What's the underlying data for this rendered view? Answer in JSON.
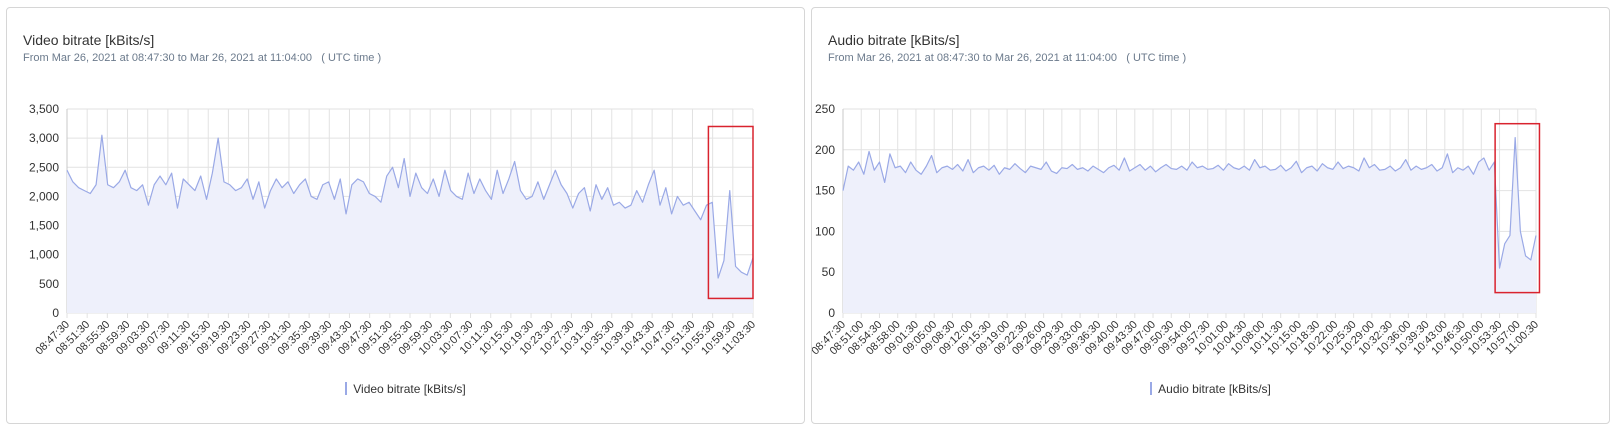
{
  "charts": [
    {
      "title": "Video bitrate [kBits/s]",
      "subtitle": "From Mar 26, 2021 at 08:47:30 to Mar 26, 2021 at 11:04:00",
      "timezone_note": "( UTC time )",
      "legend_label": "Video bitrate [kBits/s]"
    },
    {
      "title": "Audio bitrate [kBits/s]",
      "subtitle": "From Mar 26, 2021 at 08:47:30 to Mar 26, 2021 at 11:04:00",
      "timezone_note": "( UTC time )",
      "legend_label": "Audio bitrate [kBits/s]"
    }
  ],
  "colors": {
    "line": "#9aa9e6",
    "fill": "#eef0fb",
    "grid": "#e2e2e2",
    "axis_text": "#333333",
    "highlight_box": "#d9232e"
  },
  "chart_data": [
    {
      "type": "area",
      "title": "Video bitrate [kBits/s]",
      "series": [
        {
          "name": "Video bitrate [kBits/s]",
          "values": [
            2450,
            2250,
            2150,
            2100,
            2050,
            2200,
            3050,
            2200,
            2150,
            2250,
            2450,
            2150,
            2100,
            2200,
            1850,
            2200,
            2350,
            2200,
            2400,
            1800,
            2300,
            2200,
            2100,
            2350,
            1950,
            2400,
            3000,
            2250,
            2200,
            2100,
            2150,
            2300,
            1950,
            2250,
            1800,
            2100,
            2300,
            2150,
            2250,
            2050,
            2200,
            2300,
            2000,
            1950,
            2200,
            2250,
            1950,
            2300,
            1700,
            2200,
            2300,
            2250,
            2050,
            2000,
            1900,
            2350,
            2500,
            2150,
            2650,
            2000,
            2400,
            2150,
            2050,
            2300,
            2000,
            2450,
            2100,
            2000,
            1950,
            2400,
            2050,
            2300,
            2100,
            1950,
            2450,
            2050,
            2300,
            2600,
            2100,
            1950,
            2000,
            2250,
            1950,
            2200,
            2450,
            2200,
            2050,
            1800,
            2050,
            2150,
            1750,
            2200,
            1950,
            2150,
            1850,
            1900,
            1800,
            1850,
            2100,
            1900,
            2200,
            2450,
            1850,
            2150,
            1700,
            2000,
            1850,
            1900,
            1750,
            1600,
            1850,
            1900,
            600,
            900,
            2100,
            800,
            700,
            650,
            950
          ]
        }
      ],
      "x_tick_labels": [
        "08:47:30",
        "08:51:30",
        "08:55:30",
        "08:59:30",
        "09:03:30",
        "09:07:30",
        "09:11:30",
        "09:15:30",
        "09:19:30",
        "09:23:30",
        "09:27:30",
        "09:31:30",
        "09:35:30",
        "09:39:30",
        "09:43:30",
        "09:47:30",
        "09:51:30",
        "09:55:30",
        "09:59:30",
        "10:03:30",
        "10:07:30",
        "10:11:30",
        "10:15:30",
        "10:19:30",
        "10:23:30",
        "10:27:30",
        "10:31:30",
        "10:35:30",
        "10:39:30",
        "10:43:30",
        "10:47:30",
        "10:51:30",
        "10:55:30",
        "10:59:30",
        "11:03:30"
      ],
      "y_ticks": [
        0,
        500,
        1000,
        1500,
        2000,
        2500,
        3000,
        3500
      ],
      "y_tick_labels": [
        "0",
        "500",
        "1,000",
        "1,500",
        "2,000",
        "2,500",
        "3,000",
        "3,500"
      ],
      "ylim": [
        0,
        3500
      ],
      "grid": true,
      "legend_position": "bottom",
      "highlight": {
        "from_fraction": 0.935,
        "to_fraction": 1.0,
        "y_from": 250,
        "y_to": 3200
      }
    },
    {
      "type": "area",
      "title": "Audio bitrate [kBits/s]",
      "series": [
        {
          "name": "Audio bitrate [kBits/s]",
          "values": [
            150,
            180,
            175,
            185,
            170,
            198,
            175,
            185,
            160,
            195,
            178,
            180,
            172,
            185,
            175,
            170,
            180,
            193,
            172,
            178,
            180,
            176,
            182,
            174,
            188,
            172,
            178,
            180,
            175,
            181,
            170,
            178,
            176,
            183,
            177,
            172,
            180,
            178,
            176,
            185,
            174,
            171,
            178,
            177,
            182,
            176,
            178,
            174,
            180,
            176,
            172,
            178,
            181,
            175,
            190,
            174,
            178,
            182,
            175,
            180,
            173,
            178,
            182,
            177,
            176,
            180,
            175,
            185,
            178,
            180,
            176,
            177,
            181,
            175,
            183,
            178,
            176,
            180,
            175,
            188,
            178,
            180,
            175,
            176,
            181,
            174,
            178,
            186,
            172,
            178,
            180,
            174,
            183,
            178,
            176,
            185,
            177,
            180,
            178,
            174,
            190,
            178,
            182,
            175,
            176,
            180,
            174,
            178,
            188,
            175,
            180,
            176,
            178,
            182,
            174,
            178,
            195,
            172,
            178,
            175,
            180,
            170,
            185,
            190,
            175,
            185,
            55,
            85,
            95,
            215,
            100,
            70,
            65,
            95
          ]
        }
      ],
      "x_tick_labels": [
        "08:47:30",
        "08:51:00",
        "08:54:30",
        "08:58:00",
        "09:01:30",
        "09:05:00",
        "09:08:30",
        "09:12:00",
        "09:15:30",
        "09:19:00",
        "09:22:30",
        "09:26:00",
        "09:29:30",
        "09:33:00",
        "09:36:30",
        "09:40:00",
        "09:43:30",
        "09:47:00",
        "09:50:30",
        "09:54:00",
        "09:57:30",
        "10:01:00",
        "10:04:30",
        "10:08:00",
        "10:11:30",
        "10:15:00",
        "10:18:30",
        "10:22:00",
        "10:25:30",
        "10:29:00",
        "10:32:30",
        "10:36:00",
        "10:39:30",
        "10:43:00",
        "10:46:30",
        "10:50:00",
        "10:53:30",
        "10:57:00",
        "11:00:30"
      ],
      "y_ticks": [
        0,
        50,
        100,
        150,
        200,
        250
      ],
      "y_tick_labels": [
        "0",
        "50",
        "100",
        "150",
        "200",
        "250"
      ],
      "ylim": [
        0,
        250
      ],
      "grid": true,
      "legend_position": "bottom",
      "highlight": {
        "from_fraction": 0.941,
        "to_fraction": 1.005,
        "y_from": 25,
        "y_to": 232
      }
    }
  ]
}
